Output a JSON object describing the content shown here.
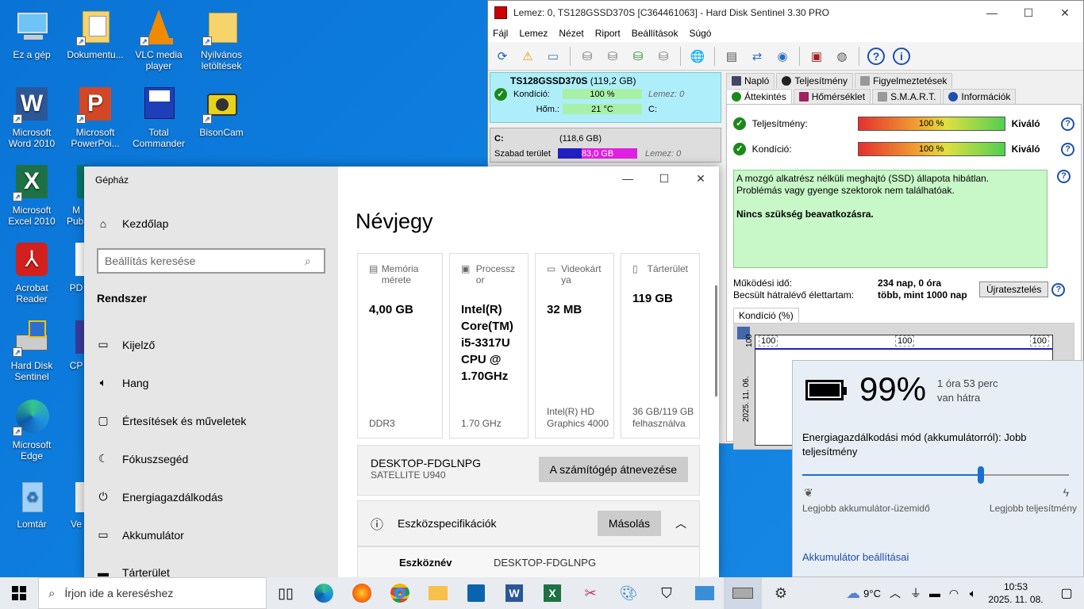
{
  "desktop": {
    "icons": [
      {
        "label": "Ez a gép"
      },
      {
        "label": "Dokumentu..."
      },
      {
        "label": "VLC media player"
      },
      {
        "label": "Nyilvános letöltések"
      },
      {
        "label": "Microsoft Word 2010"
      },
      {
        "label": "Microsoft PowerPoi..."
      },
      {
        "label": "Total Commander"
      },
      {
        "label": "BisonCam"
      },
      {
        "label": "Microsoft Excel 2010"
      },
      {
        "label": "M Publ"
      },
      {
        "label": "Acrobat Reader"
      },
      {
        "label": "PD"
      },
      {
        "label": "Hard Disk Sentinel"
      },
      {
        "label": "CP"
      },
      {
        "label": "Microsoft Edge"
      },
      {
        "label": "Lomtár"
      },
      {
        "label": "Ve"
      }
    ]
  },
  "hds": {
    "title": "Lemez: 0, TS128GSSD370S [C364461063]  -  Hard Disk Sentinel 3.30 PRO",
    "menu": [
      "Fájl",
      "Lemez",
      "Nézet",
      "Riport",
      "Beállítások",
      "Súgó"
    ],
    "disk": {
      "name": "TS128GSSD370S",
      "size": "(119,2 GB)",
      "health_label": "Kondíció:",
      "health_value": "100 %",
      "health_disk": "Lemez: 0",
      "temp_label": "Hőm.:",
      "temp_value": "21 °C",
      "temp_drive": "C:"
    },
    "volume": {
      "drive": "C:",
      "size": "(118,6 GB)",
      "free_label": "Szabad terület",
      "free_value": "83,0 GB",
      "disk": "Lemez: 0"
    },
    "tabs_row1": [
      "Napló",
      "Teljesítmény",
      "Figyelmeztetések"
    ],
    "tabs_row2": [
      "Áttekintés",
      "Hőmérséklet",
      "S.M.A.R.T.",
      "Információk"
    ],
    "performance_label": "Teljesítmény:",
    "performance_value": "100 %",
    "performance_rating": "Kiváló",
    "health_label": "Kondíció:",
    "health_value": "100 %",
    "health_rating": "Kiváló",
    "status_line1": "A mozgó alkatrész nélküli meghajtó (SSD) állapota hibátlan.",
    "status_line2": "Problémás vagy gyenge szektorok nem találhatóak.",
    "status_line3": "Nincs szükség beavatkozásra.",
    "uptime_label": "Működési idő:",
    "uptime_value": "234 nap, 0 óra",
    "remaining_label": "Becsült hátralévő élettartam:",
    "remaining_value": "több, mint 1000 nap",
    "retest_button": "Újratesztelés",
    "graph_tab": "Kondíció  (%)",
    "graph_labels": [
      "100",
      "100",
      "100"
    ],
    "graph_ylabel": "100",
    "graph_date": "2025. 11. 06."
  },
  "settings": {
    "window_title": "Gépház",
    "home": "Kezdőlap",
    "search_placeholder": "Beállítás keresése",
    "section": "Rendszer",
    "nav": [
      "Kijelző",
      "Hang",
      "Értesítések és műveletek",
      "Fókuszsegéd",
      "Energiagazdálkodás",
      "Akkumulátor",
      "Tárterület"
    ],
    "page_title": "Névjegy",
    "cards": [
      {
        "label": "Memória mérete",
        "value": "4,00 GB",
        "sub": "DDR3"
      },
      {
        "label": "Processzor",
        "value": "Intel(R) Core(TM) i5-3317U CPU @ 1.70GHz",
        "sub": "1.70 GHz"
      },
      {
        "label": "Videokártya",
        "value": "32 MB",
        "sub": "Intel(R) HD Graphics 4000"
      },
      {
        "label": "Tárterület",
        "value": "119 GB",
        "sub": "36 GB/119 GB felhasználva"
      }
    ],
    "pc_name": "DESKTOP-FDGLNPG",
    "pc_model": "SATELLITE U940",
    "rename_button": "A számítógép átnevezése",
    "spec_title": "Eszközspecifikációk",
    "copy_button": "Másolás",
    "device_name_label": "Eszköznév",
    "device_name_value": "DESKTOP-FDGLNPG"
  },
  "battery": {
    "percent": "99%",
    "remaining": "1 óra 53 perc",
    "remaining2": "van hátra",
    "mode": "Energiagazdálkodási mód (akkumulátorról): Jobb teljesítmény",
    "left_label": "Legjobb akkumulátor-üzemidő",
    "right_label": "Legjobb teljesítmény",
    "settings_link": "Akkumulátor beállításai",
    "slider_level": 0.67
  },
  "taskbar": {
    "search_placeholder": "Írjon ide a kereséshez",
    "temperature": "9°C",
    "time": "10:53",
    "date": "2025. 11. 08."
  }
}
